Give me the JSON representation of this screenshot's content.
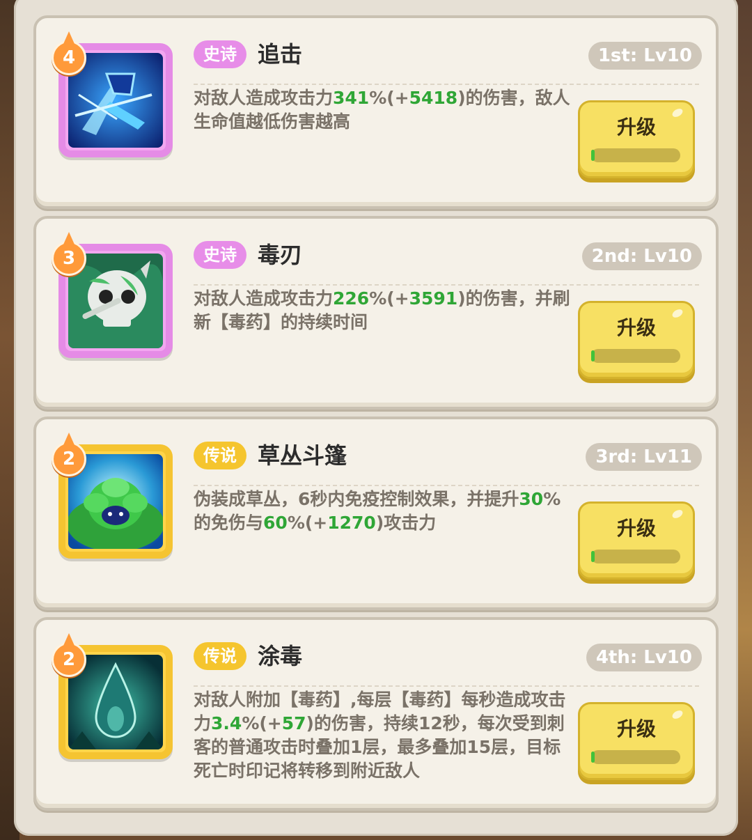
{
  "upgrade_label": "升级",
  "skills": [
    {
      "rank": "4",
      "rarity": "史诗",
      "rarity_type": "epic",
      "name": "追击",
      "level": "1st: Lv10",
      "desc": [
        {
          "t": "对敌人造成攻击力"
        },
        {
          "t": "341",
          "hl": true
        },
        {
          "t": "%(+"
        },
        {
          "t": "5418",
          "hl": true
        },
        {
          "t": ")的伤害，敌人生命值越低伤害越高"
        }
      ],
      "icon": "blue-slash-icon",
      "progress": 0.02
    },
    {
      "rank": "3",
      "rarity": "史诗",
      "rarity_type": "epic",
      "name": "毒刃",
      "level": "2nd: Lv10",
      "desc": [
        {
          "t": "对敌人造成攻击力"
        },
        {
          "t": "226",
          "hl": true
        },
        {
          "t": "%(+"
        },
        {
          "t": "3591",
          "hl": true
        },
        {
          "t": ")的伤害，并刷新【毒药】的持续时间"
        }
      ],
      "icon": "poison-skull-icon",
      "progress": 0.02
    },
    {
      "rank": "2",
      "rarity": "传说",
      "rarity_type": "legend",
      "name": "草丛斗篷",
      "level": "3rd: Lv11",
      "desc": [
        {
          "t": "伪装成草丛，6秒内免疫控制效果，并提升"
        },
        {
          "t": "30",
          "hl": true
        },
        {
          "t": "%的免伤与"
        },
        {
          "t": "60",
          "hl": true
        },
        {
          "t": "%(+"
        },
        {
          "t": "1270",
          "hl": true
        },
        {
          "t": ")攻击力"
        }
      ],
      "icon": "bush-cloak-icon",
      "progress": 0.02
    },
    {
      "rank": "2",
      "rarity": "传说",
      "rarity_type": "legend",
      "name": "涂毒",
      "level": "4th: Lv10",
      "desc": [
        {
          "t": "对敌人附加【毒药】,每层【毒药】每秒造成攻击力"
        },
        {
          "t": "3.4",
          "hl": true
        },
        {
          "t": "%(+"
        },
        {
          "t": "57",
          "hl": true
        },
        {
          "t": ")的伤害，持续12秒，每次受到刺客的普通攻击时叠加1层，最多叠加15层，目标死亡时印记将转移到附近敌人"
        }
      ],
      "icon": "poison-drop-icon",
      "progress": 0.02
    }
  ],
  "colors": {
    "epic": "#e78de8",
    "legend": "#f5c52e",
    "highlight": "#2fa636",
    "button": "#f7e063"
  }
}
